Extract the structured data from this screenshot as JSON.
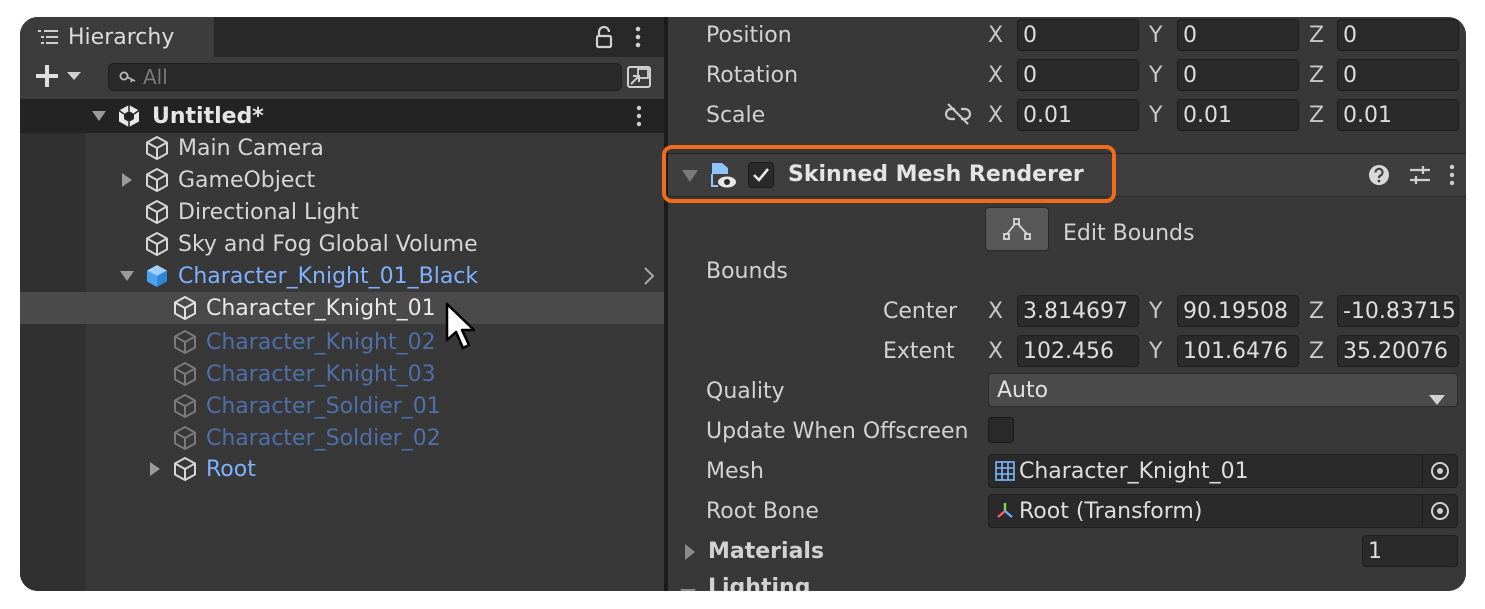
{
  "hierarchy": {
    "tab_title": "Hierarchy",
    "search_placeholder": "All",
    "scene_name": "Untitled*",
    "items": [
      {
        "label": "Main Camera"
      },
      {
        "label": "GameObject"
      },
      {
        "label": "Directional Light"
      },
      {
        "label": "Sky and Fog Global Volume"
      },
      {
        "label": "Character_Knight_01_Black"
      },
      {
        "label": "Character_Knight_01"
      },
      {
        "label": "Character_Knight_02"
      },
      {
        "label": "Character_Knight_03"
      },
      {
        "label": "Character_Soldier_01"
      },
      {
        "label": "Character_Soldier_02"
      },
      {
        "label": "Root"
      }
    ]
  },
  "transform": {
    "position": {
      "label": "Position",
      "x": "0",
      "y": "0",
      "z": "0"
    },
    "rotation": {
      "label": "Rotation",
      "x": "0",
      "y": "0",
      "z": "0"
    },
    "scale": {
      "label": "Scale",
      "x": "0.01",
      "y": "0.01",
      "z": "0.01"
    },
    "axis_x": "X",
    "axis_y": "Y",
    "axis_z": "Z"
  },
  "skinned_mesh_renderer": {
    "title": "Skinned Mesh Renderer",
    "edit_bounds_label": "Edit Bounds",
    "bounds_label": "Bounds",
    "center": {
      "label": "Center",
      "x": "3.814697",
      "y": "90.19508",
      "z": "-10.83715"
    },
    "extent": {
      "label": "Extent",
      "x": "102.456",
      "y": "101.6476",
      "z": "35.20076"
    },
    "quality_label": "Quality",
    "quality_value": "Auto",
    "update_offscreen_label": "Update When Offscreen",
    "mesh_label": "Mesh",
    "mesh_value": "Character_Knight_01",
    "root_bone_label": "Root Bone",
    "root_bone_value": "Root (Transform)",
    "materials_label": "Materials",
    "materials_count": "1",
    "lighting_label": "Lighting"
  },
  "colors": {
    "highlight": "#f26b1d",
    "prefab_text": "#7fb1ff",
    "prefab_text_inactive": "#4f6fa8"
  }
}
